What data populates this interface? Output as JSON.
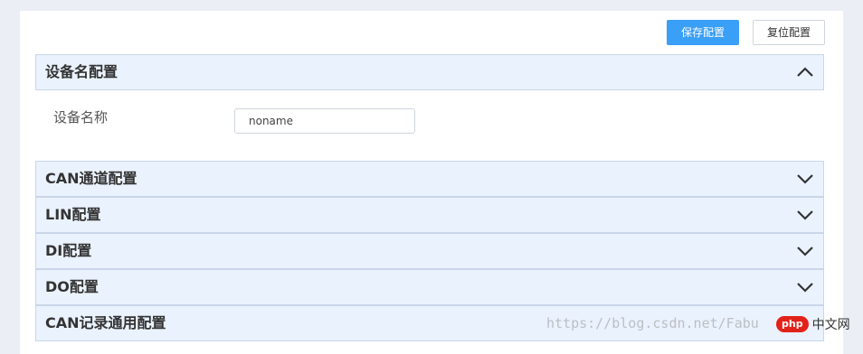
{
  "toolbar": {
    "save_label": "保存配置",
    "reset_label": "复位配置"
  },
  "sections": [
    {
      "title": "设备名配置",
      "expanded": true,
      "icon": "chevron-up-icon"
    },
    {
      "title": "CAN通道配置",
      "expanded": false,
      "icon": "chevron-down-icon"
    },
    {
      "title": "LIN配置",
      "expanded": false,
      "icon": "chevron-down-icon"
    },
    {
      "title": "DI配置",
      "expanded": false,
      "icon": "chevron-down-icon"
    },
    {
      "title": "DO配置",
      "expanded": false,
      "icon": "chevron-down-icon"
    },
    {
      "title": "CAN记录通用配置",
      "expanded": false,
      "icon": ""
    }
  ],
  "device_name": {
    "label": "设备名称",
    "value": "noname"
  },
  "watermark": {
    "url_text": "https://blog.csdn.net/Fabu",
    "logo_badge": "php",
    "logo_text": "中文网"
  },
  "colors": {
    "primary": "#3a9ff6",
    "header_bg": "#eaf2fd",
    "page_bg": "#ebeef5"
  }
}
